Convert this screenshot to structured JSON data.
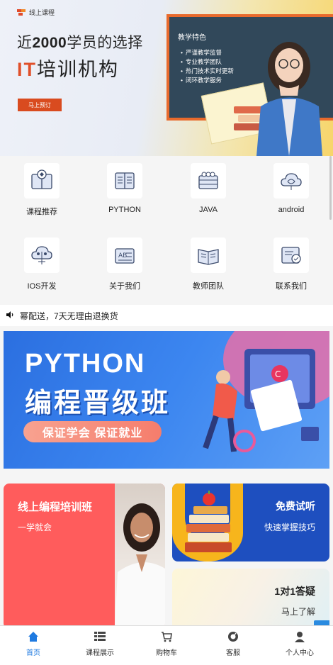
{
  "hero": {
    "logo_text": "线上课程",
    "title_line1_prefix": "近",
    "title_line1_bold": "2000",
    "title_line1_suffix": "学员的选择",
    "title_line2_accent": "IT",
    "title_line2_rest": "培训机构",
    "cta_label": "马上预订",
    "board_title": "教学特色",
    "board_items": [
      "严谨教学监督",
      "专业教学团队",
      "热门技术实时更新",
      "闭环教学服务"
    ]
  },
  "categories": [
    {
      "label": "课程推荐",
      "icon": "book-brain-icon"
    },
    {
      "label": "PYTHON",
      "icon": "document-lines-icon"
    },
    {
      "label": "JAVA",
      "icon": "team-grid-icon"
    },
    {
      "label": "android",
      "icon": "cloud-brain-icon"
    },
    {
      "label": "IOS开发",
      "icon": "cloud-tree-icon"
    },
    {
      "label": "关于我们",
      "icon": "abc-book-icon"
    },
    {
      "label": "教师团队",
      "icon": "open-book-icon"
    },
    {
      "label": "联系我们",
      "icon": "certificate-icon"
    }
  ],
  "notice": {
    "text": "幂配送，7天无理由退换货",
    "icon": "speaker-icon"
  },
  "banner": {
    "line1": "PYTHON",
    "line2": "编程晋级班",
    "pill": "保证学会 保证就业"
  },
  "cards": {
    "red": {
      "title": "线上编程培训班",
      "subtitle": "一学就会"
    },
    "blue": {
      "title": "免费试听",
      "subtitle": "快速掌握技巧"
    },
    "cream": {
      "title": "1对1答疑",
      "subtitle": "马上了解"
    }
  },
  "tabs": [
    {
      "label": "首页",
      "icon": "home-icon",
      "active": true
    },
    {
      "label": "课程展示",
      "icon": "list-icon",
      "active": false
    },
    {
      "label": "购物车",
      "icon": "cart-icon",
      "active": false
    },
    {
      "label": "客服",
      "icon": "headset-icon",
      "active": false
    },
    {
      "label": "个人中心",
      "icon": "user-icon",
      "active": false
    }
  ],
  "colors": {
    "accent": "#1f7ae0",
    "orange": "#d94b1f",
    "red_card": "#ff5c5c",
    "blue_card": "#1e4fbf"
  }
}
